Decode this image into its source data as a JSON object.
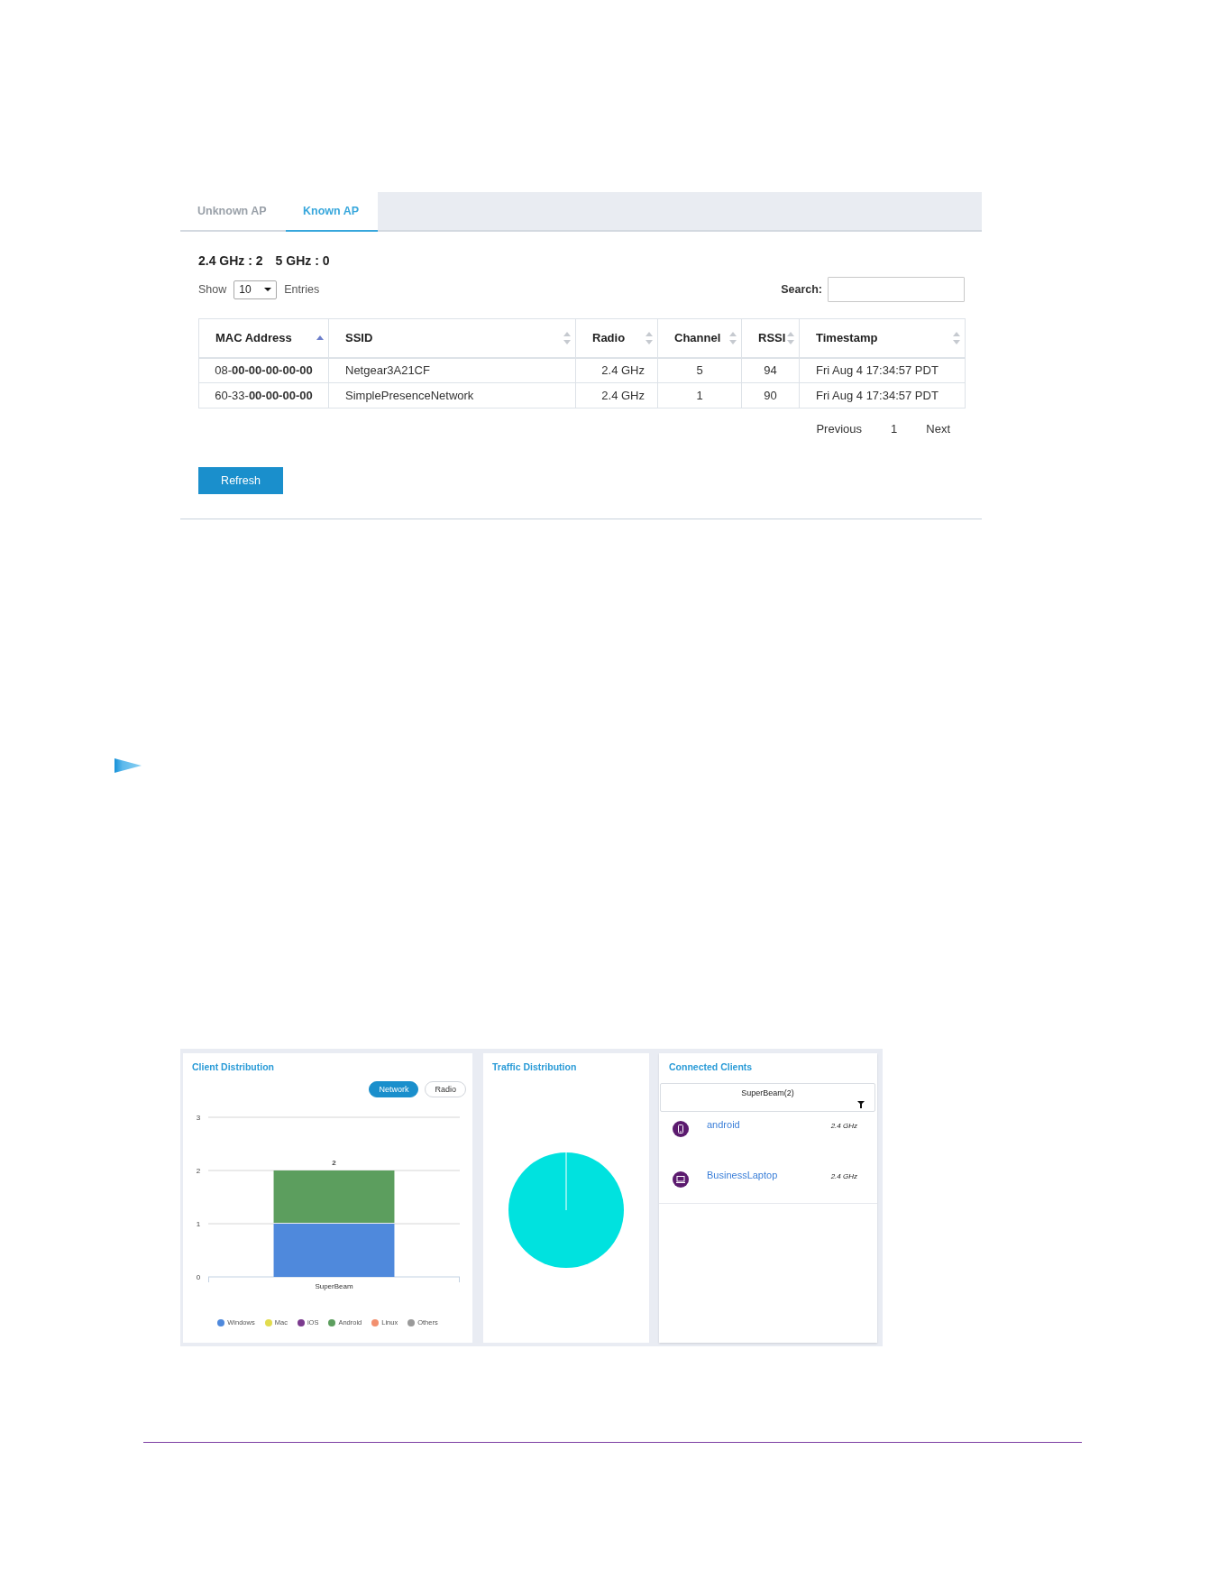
{
  "tabs": [
    {
      "label": "Unknown AP",
      "selected": false
    },
    {
      "label": "Known AP",
      "selected": true
    }
  ],
  "band_counts": [
    "2.4 GHz : 2",
    "5 GHz : 0"
  ],
  "entries": {
    "show_label": "Show",
    "value": "10",
    "entries_label": "Entries"
  },
  "search": {
    "label": "Search:"
  },
  "table": {
    "columns": [
      {
        "label": "MAC Address",
        "sorted": true
      },
      {
        "label": "SSID",
        "sorted": false
      },
      {
        "label": "Radio",
        "sorted": false
      },
      {
        "label": "Channel",
        "sorted": false
      },
      {
        "label": "RSSI",
        "sorted": false
      },
      {
        "label": "Timestamp",
        "sorted": false
      }
    ],
    "rows": [
      [
        "08-**00-00-00-00-00**",
        "Netgear3A21CF",
        "2.4 GHz",
        "5",
        "94",
        "Fri Aug 4 17:34:57 PDT"
      ],
      [
        "60-33-**00-00-00-00**",
        "SimplePresenceNetwork",
        "2.4 GHz",
        "1",
        "90",
        "Fri Aug 4 17:34:57 PDT"
      ]
    ]
  },
  "pagination": {
    "previous": "Previous",
    "pages": [
      "1"
    ],
    "next": "Next"
  },
  "refresh_button": {
    "label": "Refresh"
  },
  "dashboard": {
    "client_distribution": {
      "title": "Client Distribution",
      "toggles": [
        {
          "label": "Network",
          "selected": true
        },
        {
          "label": "Radio",
          "selected": false
        }
      ],
      "chart_data": {
        "type": "bar",
        "categories": [
          "SuperBeam"
        ],
        "series": [
          {
            "name": "Windows",
            "color": "#4f89dc",
            "values": [
              1
            ]
          },
          {
            "name": "Mac",
            "color": "#e2dc4e",
            "values": [
              0
            ]
          },
          {
            "name": "iOS",
            "color": "#7b3a8e",
            "values": [
              0
            ]
          },
          {
            "name": "Android",
            "color": "#5c9e5e",
            "values": [
              1
            ]
          },
          {
            "name": "Linux",
            "color": "#f2906f",
            "values": [
              0
            ]
          },
          {
            "name": "Others",
            "color": "#9a9a9a",
            "values": [
              0
            ]
          }
        ],
        "stacked": true,
        "ylim": [
          0,
          3
        ],
        "yticks": [
          0,
          1,
          2,
          3
        ],
        "value_labels": [
          "2"
        ],
        "legend": "bottom"
      }
    },
    "traffic_distribution": {
      "title": "Traffic Distribution"
    },
    "connected_clients": {
      "title": "Connected Clients",
      "network_filter": "SuperBeam(2)",
      "clients": [
        {
          "kind": "phone",
          "name": "android",
          "band": "2.4 GHz"
        },
        {
          "kind": "laptop",
          "name": "BusinessLaptop",
          "band": "2.4 GHz"
        }
      ]
    }
  }
}
